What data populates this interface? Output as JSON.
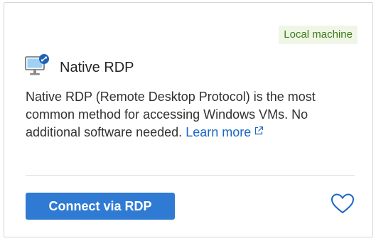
{
  "card": {
    "badge": "Local machine",
    "title": "Native RDP",
    "description": "Native RDP (Remote Desktop Protocol) is the most common method for accessing Windows VMs. No additional software needed.",
    "learn_more": "Learn more",
    "connect_label": "Connect via RDP",
    "icons": {
      "monitor": "remote-desktop-monitor-icon",
      "external_link": "external-link-icon",
      "favorite": "heart-outline-icon"
    },
    "colors": {
      "accent": "#2f7ad3",
      "link": "#1a66c2",
      "badge_bg": "#f0f6e6",
      "badge_text": "#3b7a1a"
    }
  }
}
